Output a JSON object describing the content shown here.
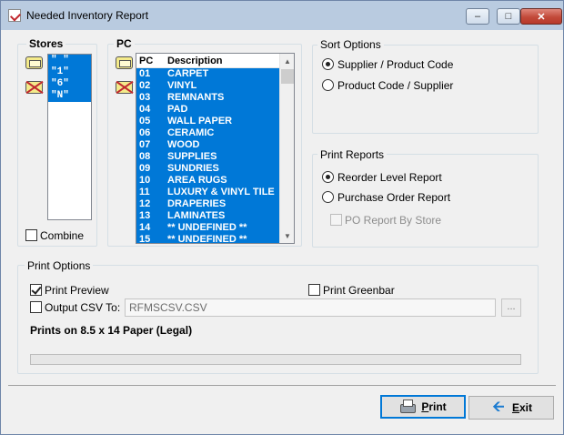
{
  "window": {
    "title": "Needed Inventory Report"
  },
  "stores": {
    "group_title": "Stores",
    "items": [
      "\" \"",
      "\"1\"",
      "\"6\"",
      "\"N\""
    ],
    "combine_label": "Combine",
    "combine_checked": false
  },
  "pc": {
    "group_title": "PC",
    "col_code": "PC",
    "col_desc": "Description",
    "rows": [
      {
        "code": "01",
        "desc": "CARPET"
      },
      {
        "code": "02",
        "desc": "VINYL"
      },
      {
        "code": "03",
        "desc": "REMNANTS"
      },
      {
        "code": "04",
        "desc": "PAD"
      },
      {
        "code": "05",
        "desc": "WALL PAPER"
      },
      {
        "code": "06",
        "desc": "CERAMIC"
      },
      {
        "code": "07",
        "desc": "WOOD"
      },
      {
        "code": "08",
        "desc": "SUPPLIES"
      },
      {
        "code": "09",
        "desc": "SUNDRIES"
      },
      {
        "code": "10",
        "desc": "AREA RUGS"
      },
      {
        "code": "11",
        "desc": "LUXURY & VINYL TILE"
      },
      {
        "code": "12",
        "desc": "DRAPERIES"
      },
      {
        "code": "13",
        "desc": "LAMINATES"
      },
      {
        "code": "14",
        "desc": "** UNDEFINED **"
      },
      {
        "code": "15",
        "desc": "** UNDEFINED **"
      }
    ]
  },
  "sort_options": {
    "group_title": "Sort Options",
    "opt1": "Supplier / Product Code",
    "opt2": "Product Code / Supplier",
    "selected": "opt1"
  },
  "print_reports": {
    "group_title": "Print Reports",
    "opt1": "Reorder Level Report",
    "opt2": "Purchase Order Report",
    "by_store": "PO Report By Store",
    "selected": "opt1"
  },
  "print_options": {
    "group_title": "Print Options",
    "preview_label": "Print Preview",
    "preview_checked": true,
    "greenbar_label": "Print Greenbar",
    "greenbar_checked": false,
    "csv_label": "Output CSV To:",
    "csv_checked": false,
    "csv_value": "RFMSCSV.CSV",
    "browse_label": "...",
    "paper_note": "Prints on 8.5 x 14 Paper (Legal)",
    "progress_value": 0
  },
  "buttons": {
    "print": "Print",
    "exit": "Exit"
  },
  "colors": {
    "selection": "#0078d7",
    "titlebar": "#b9cbe0",
    "close": "#c24a3a"
  }
}
